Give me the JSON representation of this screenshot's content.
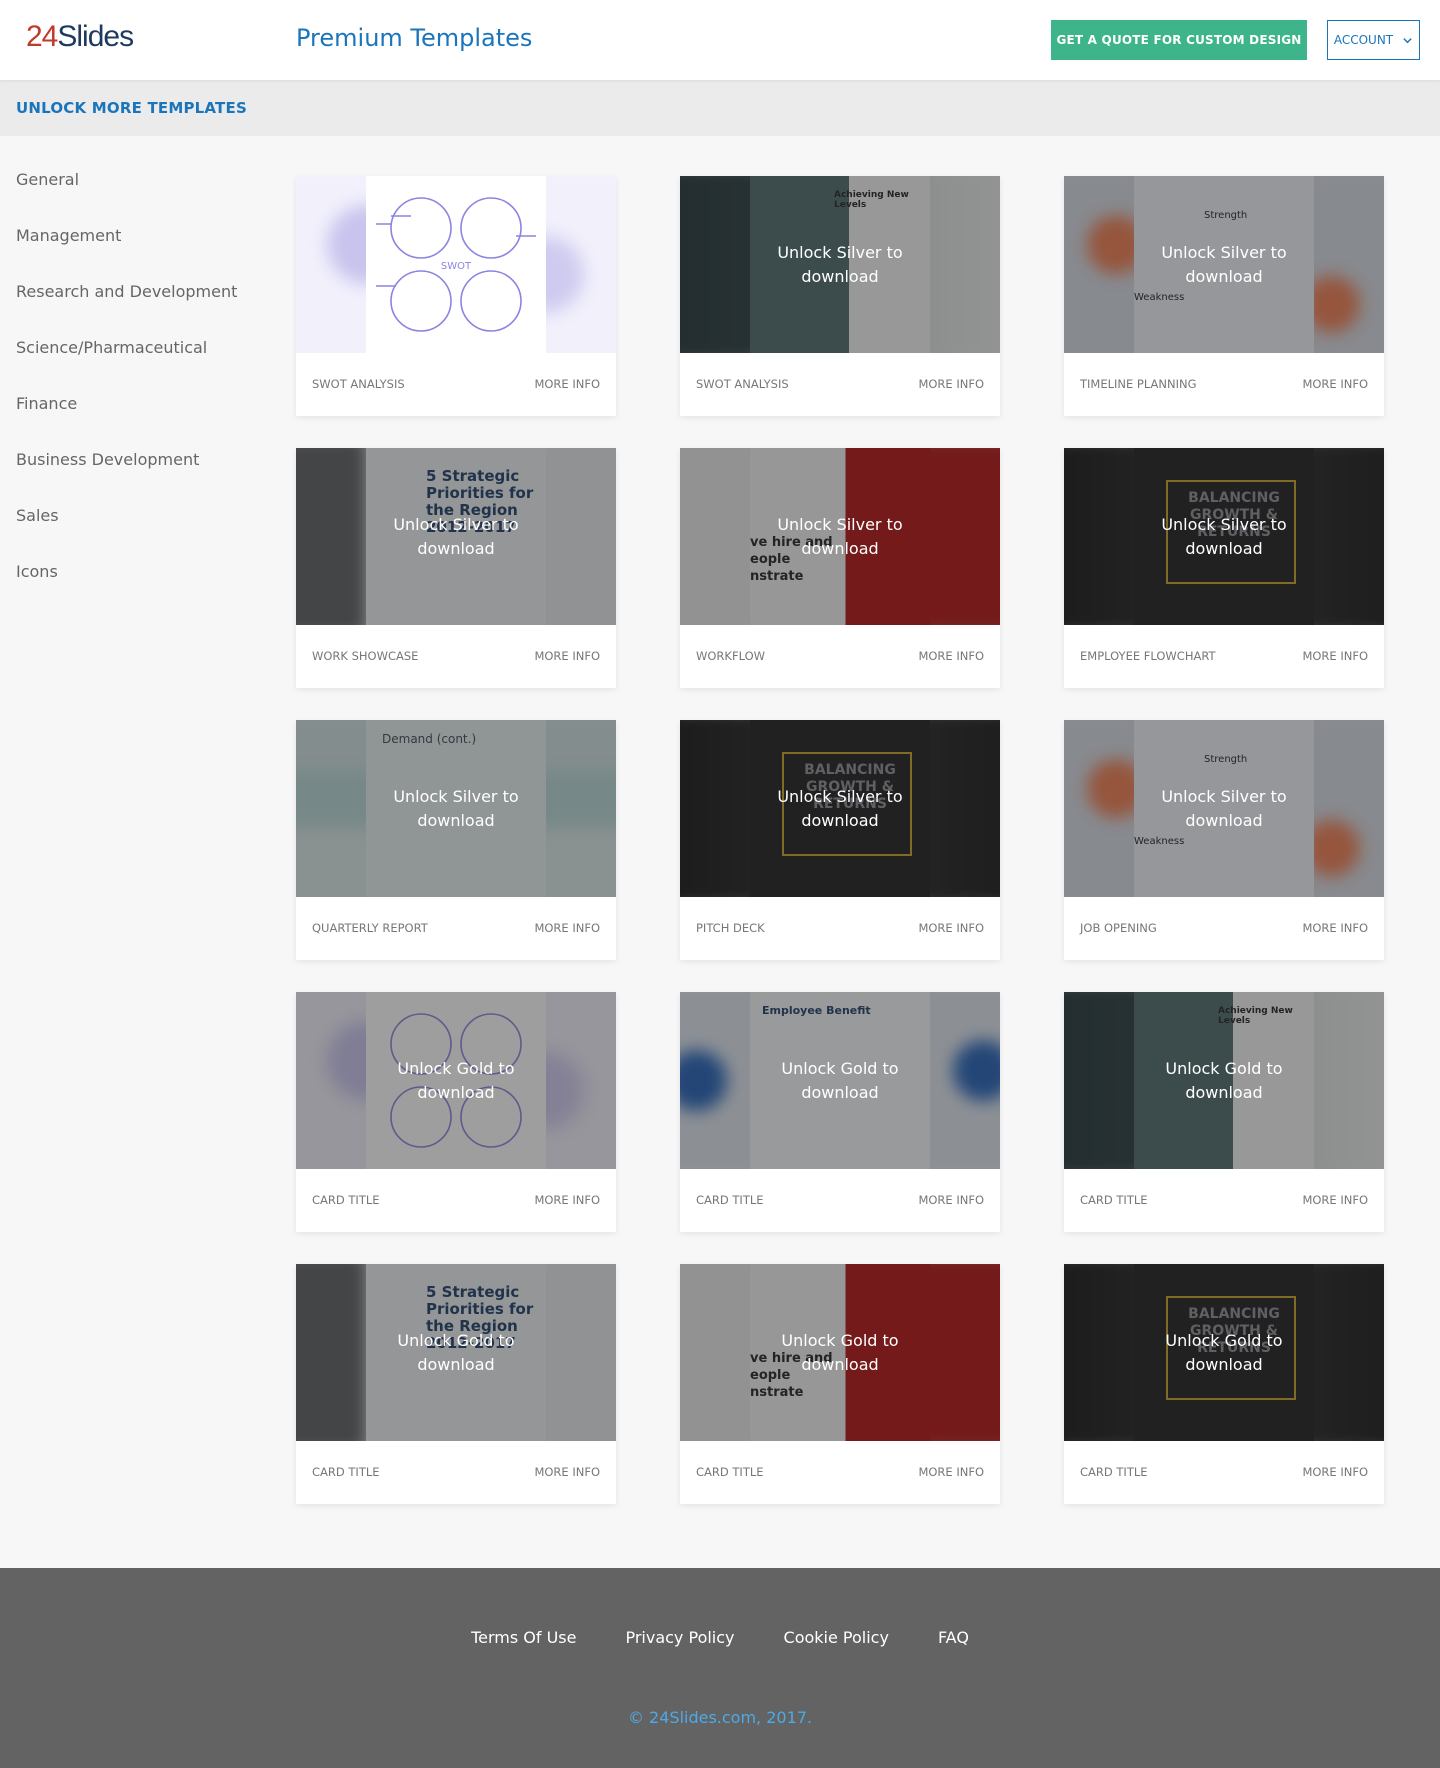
{
  "header": {
    "logo_number": "24",
    "logo_word": "Slides",
    "title": "Premium Templates",
    "quote_button": "GET A QUOTE FOR CUSTOM DESIGN",
    "account_button": "ACCOUNT"
  },
  "unlock_bar": {
    "link": "UNLOCK MORE TEMPLATES"
  },
  "sidebar": {
    "items": [
      {
        "label": "General"
      },
      {
        "label": "Management"
      },
      {
        "label": "Research and Development"
      },
      {
        "label": "Science/Pharmaceutical"
      },
      {
        "label": "Finance"
      },
      {
        "label": "Business Development"
      },
      {
        "label": "Sales"
      },
      {
        "label": "Icons"
      }
    ]
  },
  "cards": [
    {
      "title": "SWOT ANALYSIS",
      "more": "MORE INFO",
      "lock": "",
      "theme": "swot"
    },
    {
      "title": "SWOT ANALYSIS",
      "more": "MORE INFO",
      "lock": "Unlock Silver to download",
      "theme": "photo"
    },
    {
      "title": "TIMELINE PLANNING",
      "more": "MORE INFO",
      "lock": "Unlock Silver to download",
      "theme": "strength"
    },
    {
      "title": "WORK SHOWCASE",
      "more": "MORE INFO",
      "lock": "Unlock Silver to download",
      "theme": "priorities"
    },
    {
      "title": "WORKFLOW",
      "more": "MORE INFO",
      "lock": "Unlock Silver to download",
      "theme": "workflow"
    },
    {
      "title": "EMPLOYEE FLOWCHART",
      "more": "MORE INFO",
      "lock": "Unlock Silver to download",
      "theme": "dark"
    },
    {
      "title": "QUARTERLY REPORT",
      "more": "MORE INFO",
      "lock": "Unlock Silver to download",
      "theme": "teal"
    },
    {
      "title": "PITCH DECK",
      "more": "MORE INFO",
      "lock": "Unlock Silver to download",
      "theme": "dark"
    },
    {
      "title": "JOB OPENING",
      "more": "MORE INFO",
      "lock": "Unlock Silver to download",
      "theme": "strength"
    },
    {
      "title": "CARD TITLE",
      "more": "MORE INFO",
      "lock": "Unlock Gold to download",
      "theme": "swot"
    },
    {
      "title": "CARD TITLE",
      "more": "MORE INFO",
      "lock": "Unlock Gold to download",
      "theme": "benefit"
    },
    {
      "title": "CARD TITLE",
      "more": "MORE INFO",
      "lock": "Unlock Gold to download",
      "theme": "photo"
    },
    {
      "title": "CARD TITLE",
      "more": "MORE INFO",
      "lock": "Unlock Gold to download",
      "theme": "priorities"
    },
    {
      "title": "CARD TITLE",
      "more": "MORE INFO",
      "lock": "Unlock Gold to download",
      "theme": "workflow"
    },
    {
      "title": "CARD TITLE",
      "more": "MORE INFO",
      "lock": "Unlock Gold to download",
      "theme": "dark"
    }
  ],
  "thumbnail_text": {
    "swot": "SWOT",
    "achieving": "Achieving New Levels",
    "strength": "Strength",
    "weakness": "Weakness",
    "priorities": "5 Strategic Priorities for the Region 2012-2017",
    "balancing": "BALANCING GROWTH & RETURNS",
    "demand": "Demand (cont.)",
    "benefit": "Employee Benefit",
    "workflow": "ve hire and eople nstrate"
  },
  "footer": {
    "links": [
      {
        "label": "Terms Of Use"
      },
      {
        "label": "Privacy Policy"
      },
      {
        "label": "Cookie Policy"
      },
      {
        "label": "FAQ"
      }
    ],
    "copyright": "© 24Slides.com, 2017."
  },
  "colors": {
    "brand_blue": "#1a75bb",
    "quote_green": "#3db48a",
    "footer_gray": "#636363",
    "copyright_blue": "#4ea9e6"
  }
}
